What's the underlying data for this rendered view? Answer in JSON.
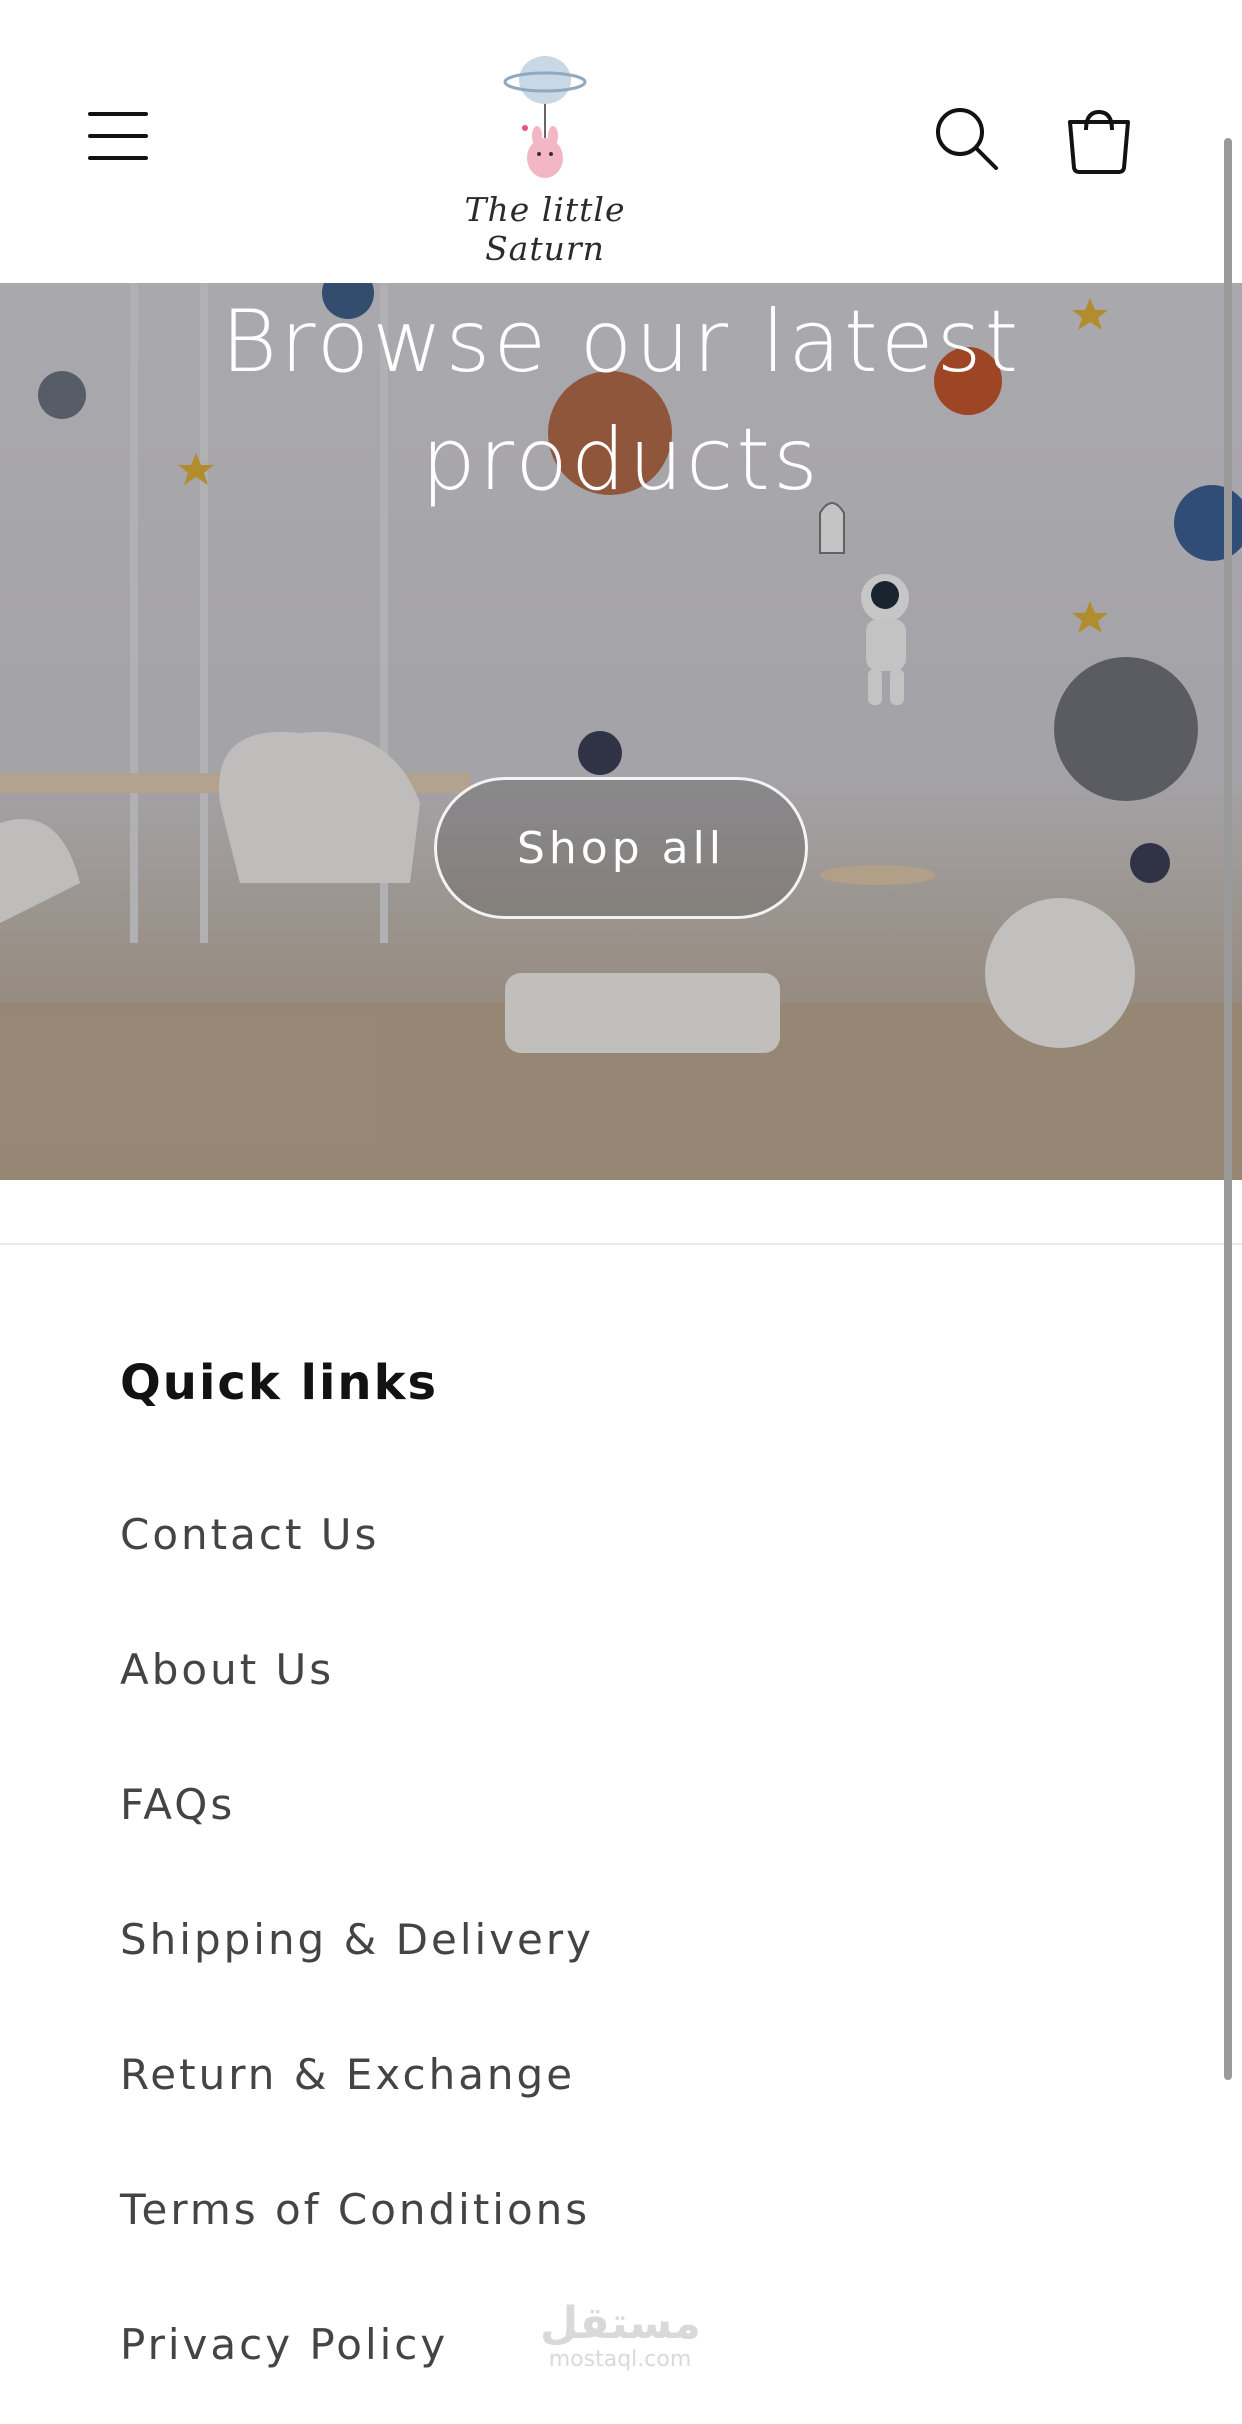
{
  "header": {
    "logo_text": "The little Saturn",
    "menu_icon": "hamburger-menu-icon",
    "search_icon": "search-icon",
    "cart_icon": "cart-icon"
  },
  "hero": {
    "title_line1": "Browse our latest",
    "title_line2": "products",
    "button_label": "Shop all"
  },
  "footer": {
    "heading": "Quick links",
    "links": [
      "Contact Us",
      "About Us",
      "FAQs",
      "Shipping & Delivery",
      "Return & Exchange",
      "Terms of Conditions",
      "Privacy Policy"
    ]
  },
  "watermark": {
    "arabic": "مستقل",
    "domain": "mostaql.com"
  }
}
